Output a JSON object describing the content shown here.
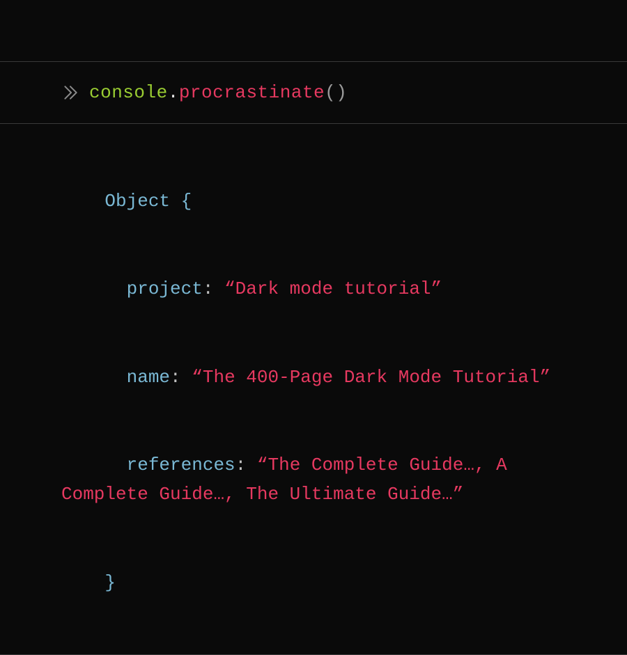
{
  "prompt": {
    "object_name": "console",
    "dot": ".",
    "method_name": "procrastinate",
    "parens": "()"
  },
  "output": {
    "type_label": "Object",
    "open_brace": " {",
    "close_brace": "}",
    "entries": {
      "project": {
        "key": "project",
        "value": "Dark mode tutorial"
      },
      "name": {
        "key": "name",
        "value": "The 400-Page Dark Mode Tutorial"
      },
      "references": {
        "key": "references",
        "value_part1": "The Complete Guide",
        "ellipsis1": "…",
        "sep1": ", ",
        "value_part2": "A Complete Guide",
        "ellipsis2": "…",
        "sep2": ", ",
        "value_part3": "The Ultimate Guide",
        "ellipsis3": "…"
      }
    },
    "colon": ":",
    "open_quote": "“",
    "close_quote": "”"
  },
  "colors": {
    "background": "#0a0a0a",
    "border": "#3a3a3a",
    "console_token": "#9acd32",
    "method_token": "#e63960",
    "type_token": "#7ab8d4",
    "key_token": "#7ab8d4",
    "string_token": "#e63960",
    "chevron": "#8a8a8a"
  }
}
